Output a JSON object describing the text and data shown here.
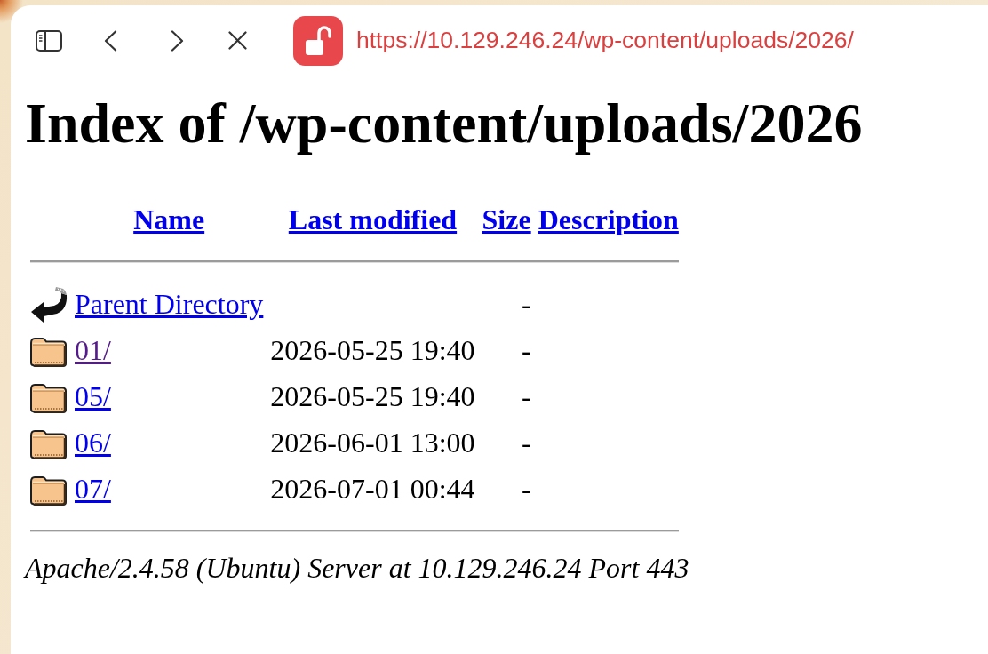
{
  "browser": {
    "address_bar": {
      "url": "https://10.129.246.24/wp-content/uploads/2026/",
      "secure": false
    }
  },
  "page": {
    "title": "Index of /wp-content/uploads/2026",
    "columns": [
      "Name",
      "Last modified",
      "Size",
      "Description"
    ],
    "rows": [
      {
        "kind": "parent",
        "name": "Parent Directory",
        "size": "-",
        "visited": false
      },
      {
        "kind": "folder",
        "name": "01/",
        "last_modified": "2026-05-25 19:40",
        "size": "-",
        "visited": true
      },
      {
        "kind": "folder",
        "name": "05/",
        "last_modified": "2026-05-25 19:40",
        "size": "-",
        "visited": false
      },
      {
        "kind": "folder",
        "name": "06/",
        "last_modified": "2026-06-01 13:00",
        "size": "-",
        "visited": false
      },
      {
        "kind": "folder",
        "name": "07/",
        "last_modified": "2026-07-01 00:44",
        "size": "-",
        "visited": false
      }
    ],
    "footer": "Apache/2.4.58 (Ubuntu) Server at 10.129.246.24 Port 443"
  }
}
